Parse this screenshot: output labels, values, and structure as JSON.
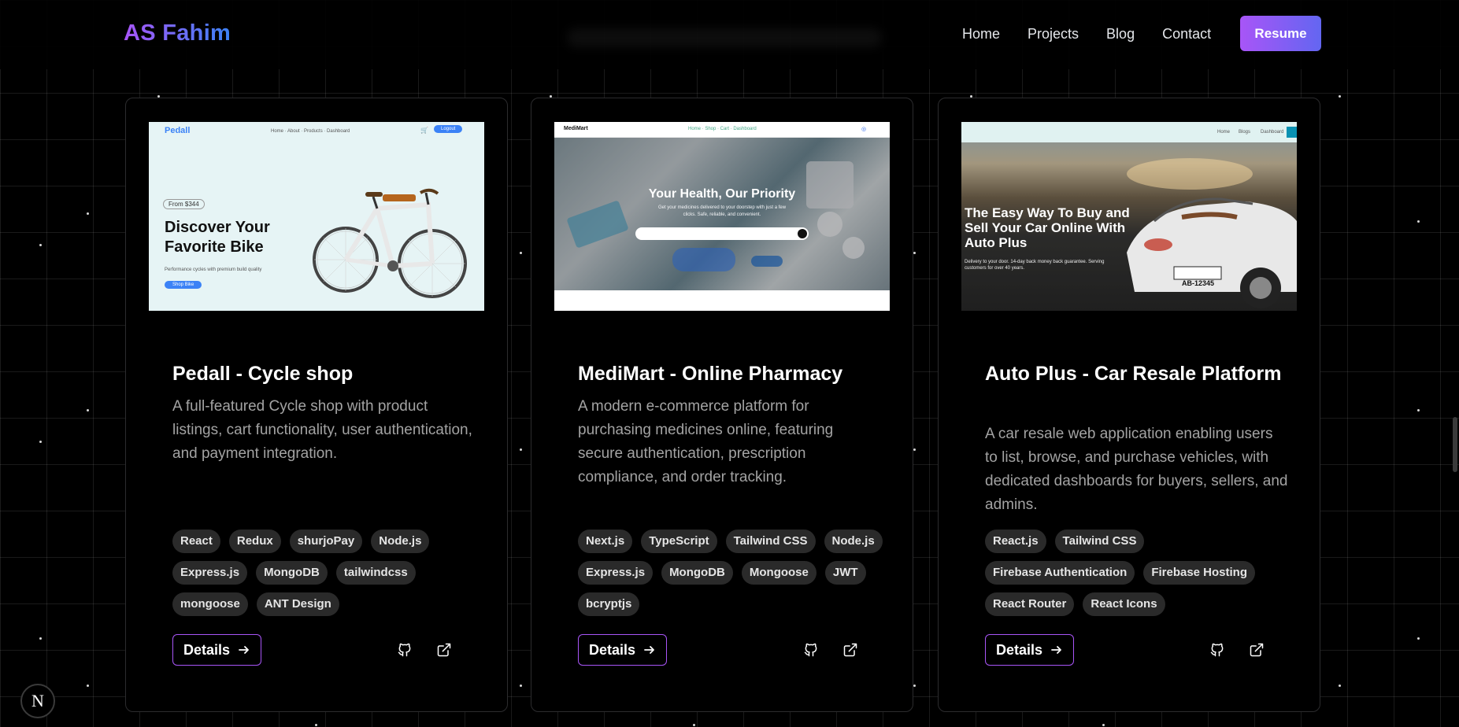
{
  "nav": {
    "brand": "AS Fahim",
    "links": [
      "Home",
      "Projects",
      "Blog",
      "Contact"
    ],
    "resume_label": "Resume"
  },
  "cards": [
    {
      "title": "Pedall - Cycle shop",
      "description": "A full-featured Cycle shop with product listings, cart functionality, user authentication, and payment integration.",
      "tags": [
        "React",
        "Redux",
        "shurjoPay",
        "Node.js",
        "Express.js",
        "MongoDB",
        "tailwindcss",
        "mongoose",
        "ANT Design"
      ],
      "details_label": "Details",
      "preview": {
        "brand": "Pedall",
        "badge": "From $344",
        "headline_line1": "Discover Your",
        "headline_line2": "Favorite Bike",
        "button": "Shop Bike",
        "login": "Logout"
      }
    },
    {
      "title": "MediMart - Online Pharmacy",
      "description": "A modern e-commerce platform for purchasing medicines online, featuring secure authentication, prescription compliance, and order tracking.",
      "tags": [
        "Next.js",
        "TypeScript",
        "Tailwind CSS",
        "Node.js",
        "Express.js",
        "MongoDB",
        "Mongoose",
        "JWT",
        "bcryptjs"
      ],
      "details_label": "Details",
      "preview": {
        "brand": "MediMart",
        "headline": "Your Health, Our Priority",
        "subtext_line1": "Get your medicines delivered to your doorstep with just a few",
        "subtext_line2": "clicks. Safe, reliable, and convenient."
      }
    },
    {
      "title": "Auto Plus - Car Resale Platform",
      "description": "A car resale web application enabling users to list, browse, and purchase vehicles, with dedicated dashboards for buyers, sellers, and admins.",
      "tags": [
        "React.js",
        "Tailwind CSS",
        "Firebase Authentication",
        "Firebase Hosting",
        "React Router",
        "React Icons"
      ],
      "details_label": "Details",
      "preview": {
        "headline_line1": "The Easy Way To Buy and",
        "headline_line2": "Sell Your Car Online With",
        "headline_line3": "Auto Plus",
        "subtext_line1": "Delivery to your door. 14-day back money back guarantee. Serving",
        "subtext_line2": "customers for over 40 years.",
        "plate": "AB-12345",
        "nav_items": [
          "Home",
          "Blogs",
          "Dashboard"
        ]
      }
    }
  ],
  "next_badge": "N",
  "colors": {
    "accent_purple": "#a855f7",
    "accent_blue": "#3b82f6",
    "background": "#000000",
    "tag_bg": "#2a2a2a"
  },
  "icons": [
    "github-icon",
    "external-link-icon",
    "arrow-right-icon",
    "cart-icon"
  ]
}
